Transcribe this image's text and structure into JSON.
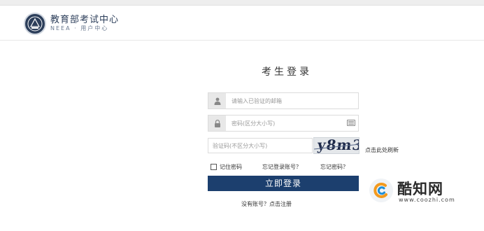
{
  "header": {
    "title": "教育部考试中心",
    "subtitle": "NEEA · 用户中心"
  },
  "login": {
    "title": "考生登录",
    "username": {
      "placeholder": "请输入已验证的邮箱",
      "value": ""
    },
    "password": {
      "placeholder": "密码(区分大小写)",
      "value": ""
    },
    "captcha": {
      "placeholder": "验证码(不区分大小写)",
      "value": "",
      "image_text": "y8m3",
      "refresh_label": "点击此处刷新"
    },
    "remember_label": "记住密码",
    "forgot_account_label": "忘记登录账号？",
    "forgot_password_label": "忘记密码？",
    "submit_label": "立即登录",
    "register_label": "没有账号？点击注册"
  },
  "watermark": {
    "title": "酷知网",
    "url": "www.coozhi.com"
  },
  "colors": {
    "primary_button": "#1c3f6e",
    "logo": "#2c3e5a",
    "watermark_orange": "#f39a1e",
    "watermark_blue": "#1e8fd8"
  },
  "icons": {
    "username": "user-icon",
    "password": "lock-icon",
    "keyboard": "keyboard-icon"
  }
}
